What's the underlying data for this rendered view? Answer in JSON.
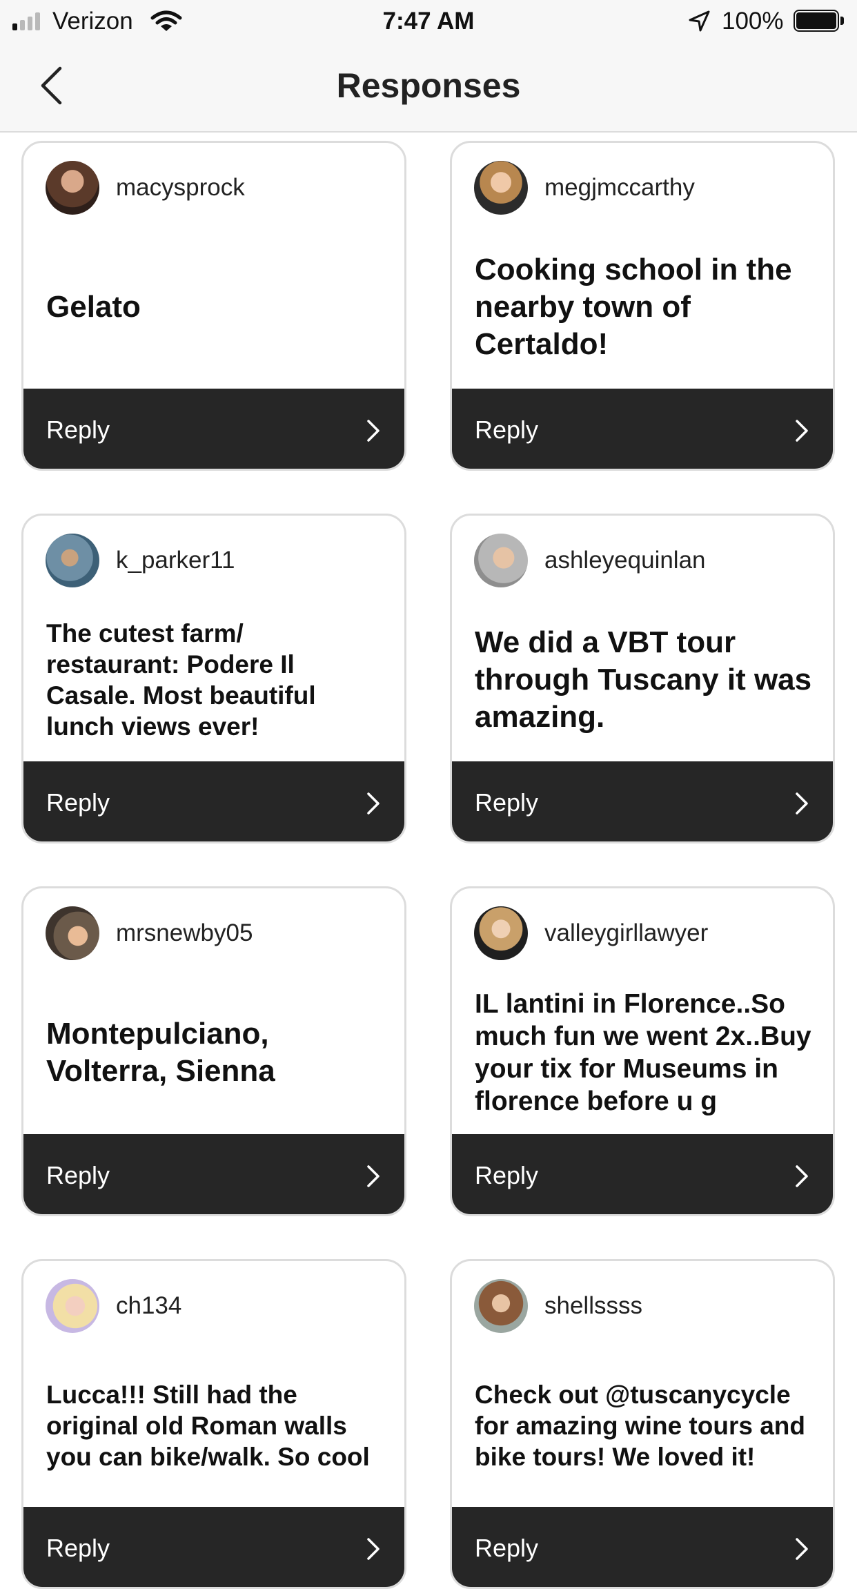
{
  "status_bar": {
    "carrier": "Verizon",
    "time": "7:47 AM",
    "battery": "100%",
    "icons": [
      "signal-icon",
      "wifi-icon",
      "location-arrow-icon",
      "battery-icon"
    ]
  },
  "nav": {
    "title": "Responses",
    "back_icon": "chevron-left-icon"
  },
  "colors": {
    "reply_bar": "#262626",
    "card_border": "#dcdcdc",
    "header_bg": "#f7f7f7"
  },
  "responses": [
    {
      "username": "macysprock",
      "text": "Gelato",
      "reply_label": "Reply"
    },
    {
      "username": "megjmccarthy",
      "text": "Cooking school in the nearby town of Certaldo!",
      "reply_label": "Reply"
    },
    {
      "username": "k_parker11",
      "text": "The cutest farm/ restaurant: Podere Il Casale. Most beautiful lunch views ever!",
      "reply_label": "Reply"
    },
    {
      "username": "ashleyequinlan",
      "text": "We did a VBT tour through Tuscany it was amazing.",
      "reply_label": "Reply"
    },
    {
      "username": "mrsnewby05",
      "text": "Montepulciano, Volterra, Sienna",
      "reply_label": "Reply"
    },
    {
      "username": "valleygirllawyer",
      "text": "IL lantini in Florence..So much fun we went 2x..Buy your tix for Museums in florence before u g",
      "reply_label": "Reply"
    },
    {
      "username": "ch134",
      "text": "Lucca!!! Still had the original old Roman walls you can bike/walk. So cool",
      "reply_label": "Reply"
    },
    {
      "username": "shellssss",
      "text": "Check out @tuscanycycle for amazing wine tours and bike tours! We loved it!",
      "reply_label": "Reply"
    }
  ]
}
